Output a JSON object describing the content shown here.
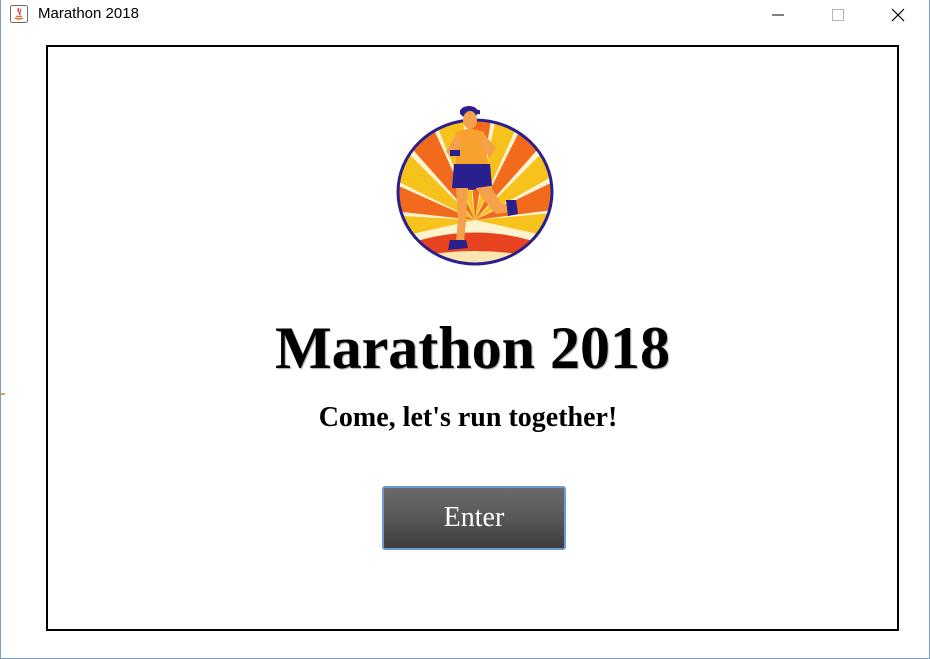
{
  "window": {
    "title": "Marathon 2018",
    "icon": "java-icon",
    "controls": [
      "minimize-icon",
      "maximize-icon",
      "close-icon"
    ]
  },
  "main": {
    "logo": "marathon-runner-logo",
    "heading": "Marathon 2018",
    "subheading": "Come, let's run together!",
    "enter_label": "Enter"
  },
  "colors": {
    "panel_border": "#000000",
    "button_bg": "#5a5a5a",
    "button_border": "#6f9ad1",
    "button_text": "#ffffff",
    "logo_ring": "#2a1f8f",
    "logo_rays_orange": "#f26a1b",
    "logo_rays_yellow": "#f7c21b"
  }
}
